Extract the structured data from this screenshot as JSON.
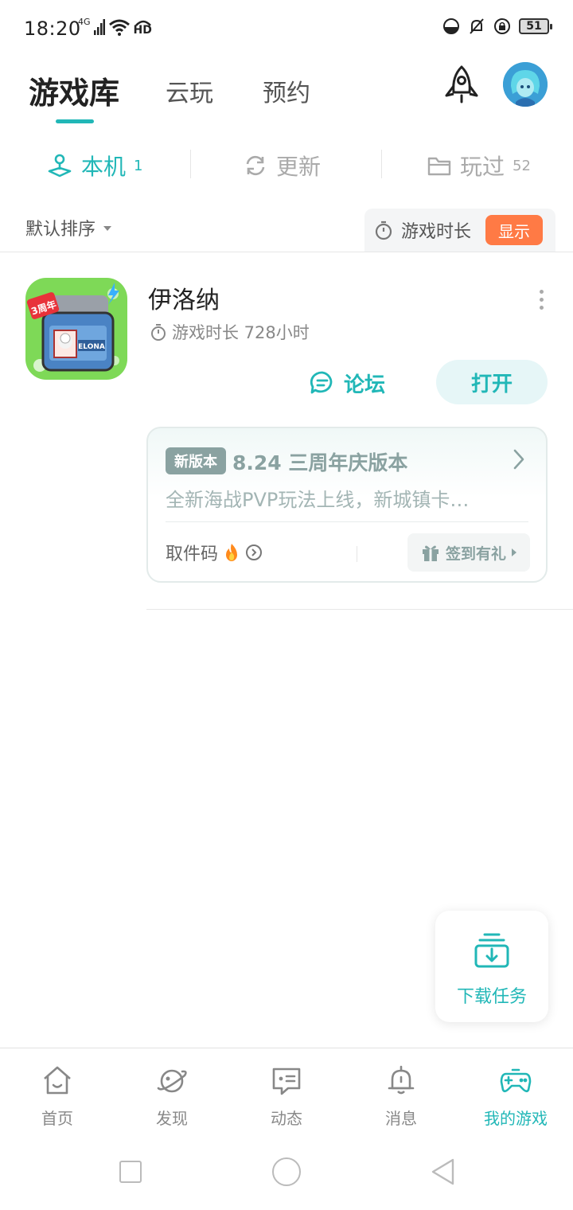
{
  "status_bar": {
    "time": "18:20",
    "network": "4G",
    "hd": "HD",
    "battery": "51"
  },
  "top_tabs": {
    "library": "游戏库",
    "cloud": "云玩",
    "reserve": "预约"
  },
  "sub_tabs": {
    "local_label": "本机",
    "local_count": "1",
    "update_label": "更新",
    "played_label": "玩过",
    "played_count": "52"
  },
  "sort": {
    "label": "默认排序",
    "playtime_label": "游戏时长",
    "show_button": "显示"
  },
  "game": {
    "name": "伊洛纳",
    "playtime": "游戏时长 728小时",
    "forum_button": "论坛",
    "open_button": "打开",
    "icon_badge_text": "3周年",
    "icon_logo_text": "ELONA"
  },
  "update_card": {
    "badge": "新版本",
    "title": "8.24 三周年庆版本",
    "description": "全新海战PVP玩法上线，新城镇卡…",
    "code_label": "取件码",
    "gift_label": "签到有礼"
  },
  "download": {
    "label": "下载任务"
  },
  "bottom_nav": {
    "items": [
      {
        "label": "首页",
        "icon": "home-icon"
      },
      {
        "label": "发现",
        "icon": "planet-icon"
      },
      {
        "label": "动态",
        "icon": "chat-icon"
      },
      {
        "label": "消息",
        "icon": "bell-icon"
      },
      {
        "label": "我的游戏",
        "icon": "gamepad-icon"
      }
    ],
    "active_index": 4
  },
  "colors": {
    "accent": "#21b7b7",
    "orange": "#ff7a45",
    "muted_teal": "#8aa2a1"
  }
}
